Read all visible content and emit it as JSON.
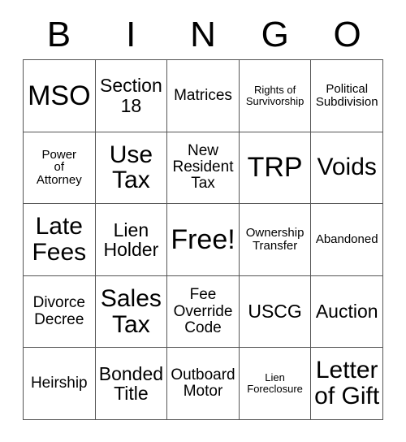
{
  "card": {
    "header_letters": [
      "B",
      "I",
      "N",
      "G",
      "O"
    ],
    "rows": [
      [
        {
          "text": "MSO",
          "size": "xl"
        },
        {
          "text": "Section\n18",
          "size": "md"
        },
        {
          "text": "Matrices",
          "size": "sm"
        },
        {
          "text": "Rights of\nSurvivorship",
          "size": "xxs"
        },
        {
          "text": "Political\nSubdivision",
          "size": "xs"
        }
      ],
      [
        {
          "text": "Power\nof\nAttorney",
          "size": "xs"
        },
        {
          "text": "Use\nTax",
          "size": "lg"
        },
        {
          "text": "New\nResident\nTax",
          "size": "sm"
        },
        {
          "text": "TRP",
          "size": "xl"
        },
        {
          "text": "Voids",
          "size": "lg"
        }
      ],
      [
        {
          "text": "Late\nFees",
          "size": "lg"
        },
        {
          "text": "Lien\nHolder",
          "size": "md"
        },
        {
          "text": "Free!",
          "size": "xl"
        },
        {
          "text": "Ownership\nTransfer",
          "size": "xs"
        },
        {
          "text": "Abandoned",
          "size": "xs"
        }
      ],
      [
        {
          "text": "Divorce\nDecree",
          "size": "sm"
        },
        {
          "text": "Sales\nTax",
          "size": "lg"
        },
        {
          "text": "Fee\nOverride\nCode",
          "size": "sm"
        },
        {
          "text": "USCG",
          "size": "md"
        },
        {
          "text": "Auction",
          "size": "md"
        }
      ],
      [
        {
          "text": "Heirship",
          "size": "sm"
        },
        {
          "text": "Bonded\nTitle",
          "size": "md"
        },
        {
          "text": "Outboard\nMotor",
          "size": "sm"
        },
        {
          "text": "Lien\nForeclosure",
          "size": "xxs"
        },
        {
          "text": "Letter\nof Gift",
          "size": "lg"
        }
      ]
    ],
    "colors": {
      "background": "#ffffff",
      "text": "#000000",
      "grid_line": "#555555"
    }
  }
}
